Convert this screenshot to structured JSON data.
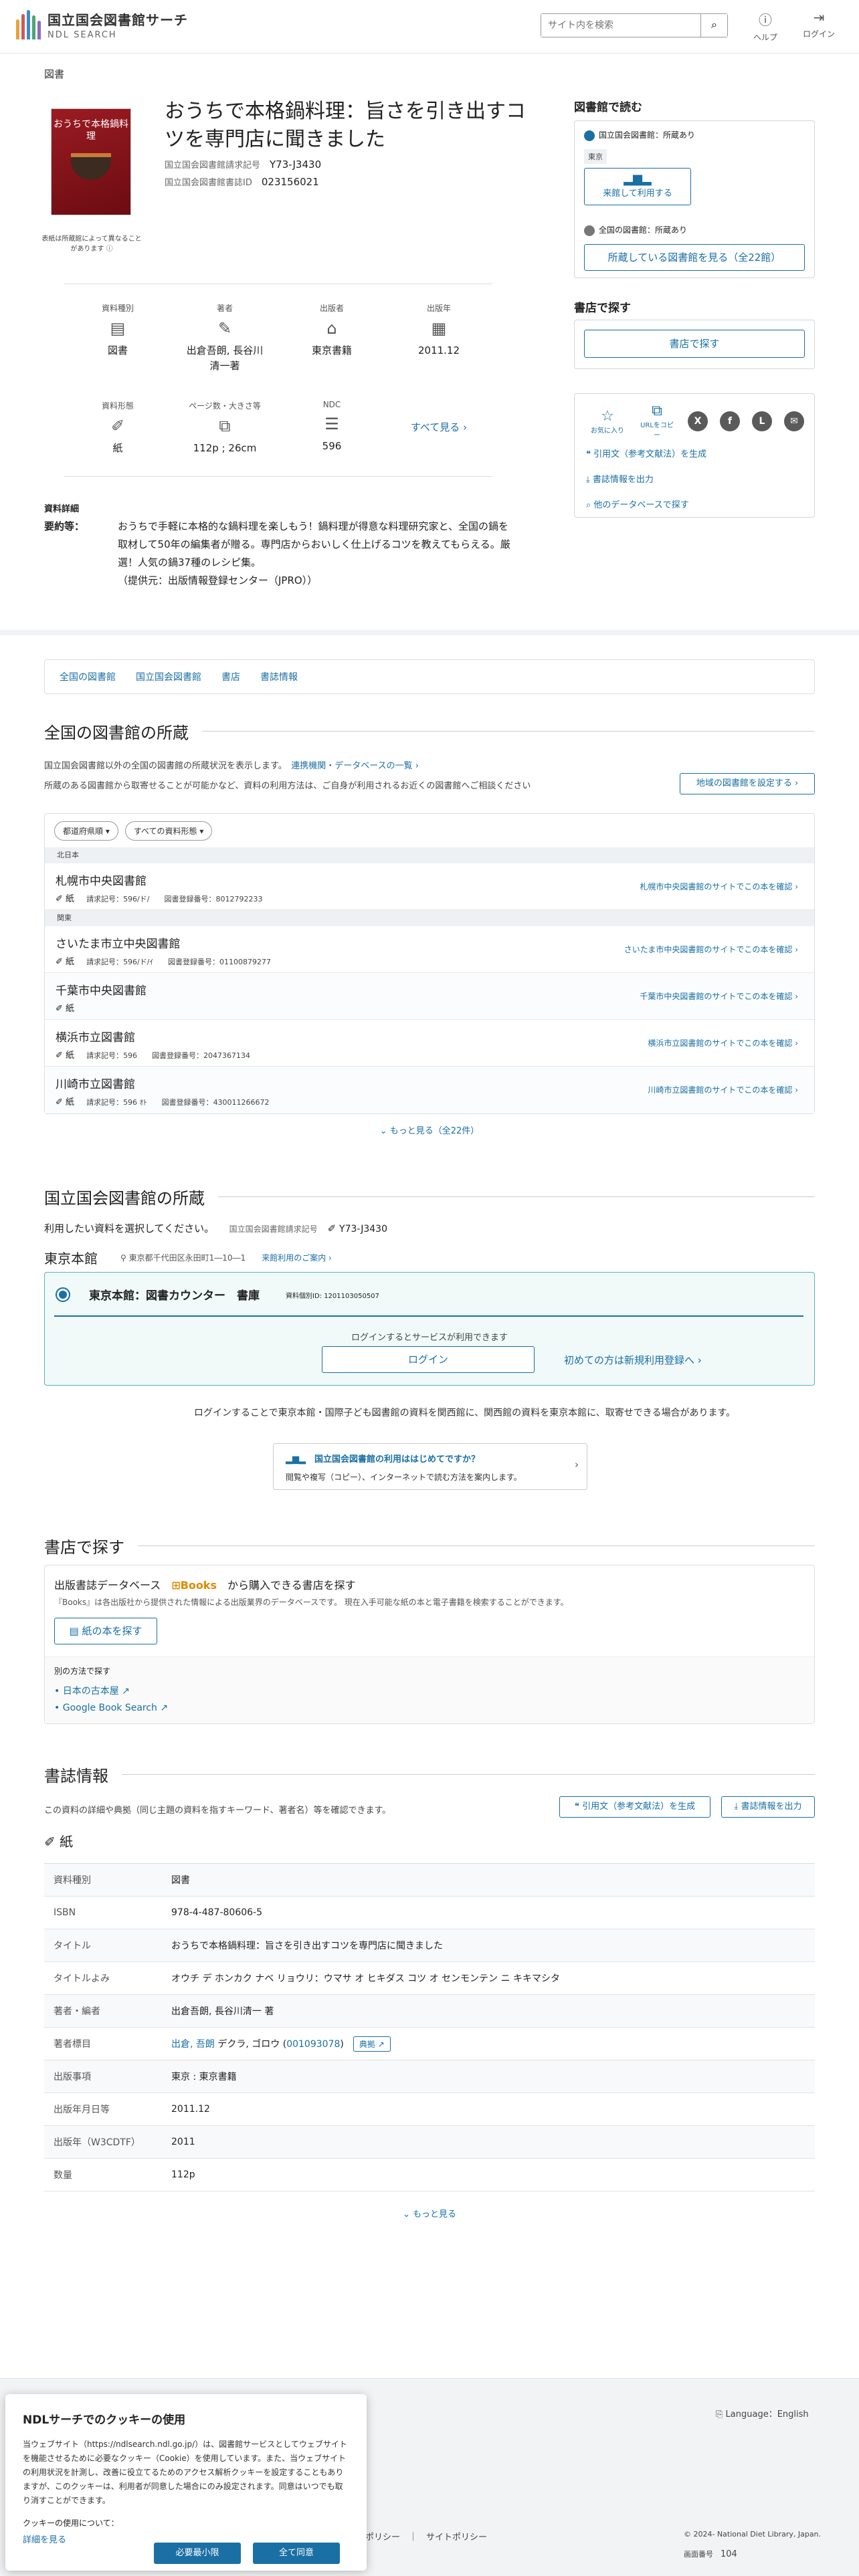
{
  "header": {
    "logo_title": "国立国会図書館サーチ",
    "logo_sub": "NDL SEARCH",
    "search_placeholder": "サイト内を検索",
    "help": "ヘルプ",
    "login": "ログイン"
  },
  "breadcrumb": "図書",
  "book": {
    "cover_text": "おうちで本格鍋料理",
    "image_note": "表紙は所蔵館によって異なることがあります",
    "title": "おうちで本格鍋料理：旨さを引き出すコツを専門店に聞きました",
    "call_label": "国立国会図書館請求記号",
    "call_value": "Y73-J3430",
    "id_label": "国立国会図書館書誌ID",
    "id_value": "023156021"
  },
  "facts_row1": [
    {
      "label": "資料種別",
      "icon": "book-icon",
      "glyph": "▤",
      "value": "図書"
    },
    {
      "label": "著者",
      "icon": "pen-icon",
      "glyph": "✎",
      "value": "出倉吾朗, 長谷川清一著"
    },
    {
      "label": "出版者",
      "icon": "building-icon",
      "glyph": "🏛",
      "value": "東京書籍"
    },
    {
      "label": "出版年",
      "icon": "calendar-icon",
      "glyph": "▦",
      "value": "2011.12"
    }
  ],
  "facts_row2": [
    {
      "label": "資料形態",
      "icon": "paper-icon",
      "glyph": "✐",
      "value": "紙"
    },
    {
      "label": "ページ数・大きさ等",
      "icon": "ruler-icon",
      "glyph": "⧉",
      "value": "112p ; 26cm"
    },
    {
      "label": "NDC",
      "icon": "list-icon",
      "glyph": "☰",
      "value": "596"
    }
  ],
  "see_all": "すべて見る",
  "detail": {
    "label": "資料詳細",
    "key": "要約等：",
    "text": "おうちで手軽に本格的な鍋料理を楽しもう！鍋料理が得意な料理研究家と、全国の鍋を取材して50年の編集者が贈る。専門店からおいしく仕上げるコツを教えてもらえる。厳選！人気の鍋37種のレシピ集。",
    "source": "（提供元：出版情報登録センター（JPRO））"
  },
  "right": {
    "read_heading": "図書館で読む",
    "ndl_have": "国立国会図書館：所蔵あり",
    "tokyo_tag": "東京",
    "visit_btn": "来館して利用する",
    "nationwide_have": "全国の図書館：所蔵あり",
    "see_libs_btn": "所蔵している図書館を見る（全22館）",
    "store_heading": "書店で探す",
    "store_btn": "書店で探す",
    "fav": "お気に入り",
    "url_copy": "URLをコピー",
    "cite_link": "引用文（参考文献法）を生成",
    "export_link": "書誌情報を出力",
    "other_db_link": "他のデータベースで探す"
  },
  "tabs": [
    "全国の図書館",
    "国立国会図書館",
    "書店",
    "書誌情報"
  ],
  "nationwide": {
    "heading": "全国の図書館の所蔵",
    "desc1": "国立国会図書館以外の全国の図書館の所蔵状況を表示します。",
    "desc_link": "連携機関・データベースの一覧",
    "desc2": "所蔵のある図書館から取寄せることが可能かなど、資料の利用方法は、ご自身が利用されるお近くの図書館へご相談ください",
    "region_btn": "地域の図書館を設定する",
    "filter_pref": "都道府県順",
    "filter_type": "すべての資料形態",
    "more": "もっと見る（全22件）"
  },
  "regions": {
    "hokkaido": "北日本",
    "kanto": "関東"
  },
  "libraries": [
    {
      "name": "札幌市中央図書館",
      "form": "紙",
      "call": "596/ド/",
      "reg": "8012792233",
      "link": "札幌市中央図書館のサイトでこの本を確認"
    },
    {
      "name": "さいたま市立中央図書館",
      "form": "紙",
      "call": "596/ド/ｲ",
      "reg": "01100879277",
      "link": "さいたま市中央図書館のサイトでこの本を確認"
    },
    {
      "name": "千葉市中央図書館",
      "form": "紙",
      "call": "",
      "reg": "",
      "link": "千葉市中央図書館のサイトでこの本を確認"
    },
    {
      "name": "横浜市立図書館",
      "form": "紙",
      "call": "596",
      "reg": "2047367134",
      "link": "横浜市立図書館のサイトでこの本を確認"
    },
    {
      "name": "川崎市立図書館",
      "form": "紙",
      "call": "596 ｵﾄ",
      "reg": "430011266672",
      "link": "川崎市立図書館のサイトでこの本を確認"
    }
  ],
  "lib_labels": {
    "call": "請求記号：",
    "reg": "図書登録番号："
  },
  "ndl": {
    "heading": "国立国会図書館の所蔵",
    "choose": "利用したい資料を選択してください。",
    "call_label": "国立国会図書館請求記号",
    "call_value": "Y73-J3430",
    "branch": "東京本館",
    "address": "東京都千代田区永田町1―10―1",
    "guide_link": "来館利用のご案内",
    "counter": "東京本館：図書カウンター　書庫",
    "material_id": "資料個別ID: 1201103050507",
    "login_prompt": "ログインするとサービスが利用できます",
    "login_btn": "ログイン",
    "register_link": "初めての方は新規利用登録へ",
    "notice": "ログインすることで東京本館・国際子ども図書館の資料を関西館に、関西館の資料を東京本館に、取寄せできる場合があります。",
    "guide_title": "国立国会図書館の利用ははじめてですか？",
    "guide_desc": "閲覧や複写（コピー）、インターネットで読む方法を案内します。"
  },
  "store": {
    "heading": "書店で探す",
    "db_prefix": "出版書誌データベース",
    "books_brand": "Books",
    "db_suffix": "から購入できる書店を探す",
    "db_desc": "『Books』は各出版社から提供された情報による出版業界のデータベースです。 現在入手可能な紙の本と電子書籍を検索することができます。",
    "paper_btn": "紙の本を探す",
    "other_label": "別の方法で探す",
    "other1": "日本の古本屋",
    "other2": "Google Book Search"
  },
  "biblio": {
    "heading": "書誌情報",
    "desc": "この資料の詳細や典拠（同じ主題の資料を指すキーワード、著者名）等を確認できます。",
    "cite_btn": "引用文（参考文献法）を生成",
    "export_btn": "書誌情報を出力",
    "form": "紙",
    "rows": [
      {
        "k": "資料種別",
        "v": "図書",
        "link": false
      },
      {
        "k": "ISBN",
        "v": "978-4-487-80606-5",
        "link": false
      },
      {
        "k": "タイトル",
        "v": "おうちで本格鍋料理：旨さを引き出すコツを専門店に聞きました",
        "link": true
      },
      {
        "k": "タイトルよみ",
        "v": "オウチ デ ホンカク ナベ リョウリ：ウマサ オ ヒキダス コツ オ センモンテン ニ キキマシタ",
        "link": false
      },
      {
        "k": "著者・編者",
        "v": "出倉吾朗, 長谷川清一 著",
        "link": false
      },
      {
        "k": "著者標目",
        "v": "出倉, 吾朗",
        "link": true
      },
      {
        "k": "出版事項",
        "v": "東京 : 東京書籍",
        "link": true
      },
      {
        "k": "出版年月日等",
        "v": "2011.12",
        "link": false
      },
      {
        "k": "出版年（W3CDTF）",
        "v": "2011",
        "link": false
      },
      {
        "k": "数量",
        "v": "112p",
        "link": false
      }
    ],
    "author_reading": "デクラ, ゴロウ",
    "author_id": "001093078",
    "tenkyo_btn": "典拠",
    "more": "もっと見る"
  },
  "footer": {
    "language": "Language：English",
    "policy": "ポリシー",
    "site_policy": "サイトポリシー",
    "copyright": "© 2024- National Diet Library, Japan.",
    "screen_label": "画面番号",
    "screen_num": "104"
  },
  "cookie": {
    "title": "NDLサーチでのクッキーの使用",
    "body": "当ウェブサイト（https://ndlsearch.ndl.go.jp/）は、図書館サービスとしてウェブサイトを機能させるために必要なクッキー（Cookie）を使用しています。また、当ウェブサイトの利用状況を計測し、改善に役立てるためのアクセス解析クッキーを設定することもありますが、このクッキーは、利用者が同意した場合にのみ設定されます。同意はいつでも取り消すことができます。",
    "usage_label": "クッキーの使用について：",
    "details": "詳細を見る",
    "minimal_btn": "必要最小限",
    "accept_btn": "全て同意"
  }
}
